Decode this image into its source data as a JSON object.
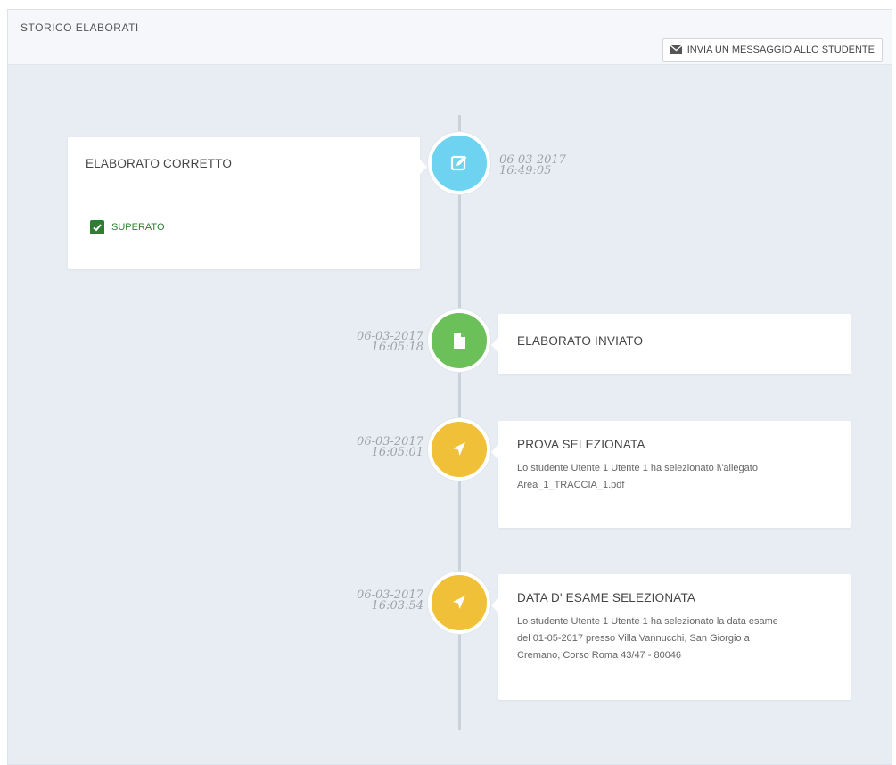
{
  "header": {
    "title": "STORICO ELABORATI",
    "message_button_label": "INVIA UN MESSAGGIO ALLO STUDENTE",
    "message_button_icon": "envelope-icon"
  },
  "events": [
    {
      "date": "06-03-2017",
      "time": "16:49:05",
      "title": "ELABORATO CORRETTO",
      "status": "SUPERATO",
      "icon": "edit-icon",
      "color": "#6dd3f0",
      "side": "left"
    },
    {
      "date": "06-03-2017",
      "time": "16:05:18",
      "title": "ELABORATO INVIATO",
      "icon": "file-icon",
      "color": "#6cc05a",
      "side": "right"
    },
    {
      "date": "06-03-2017",
      "time": "16:05:01",
      "title": "PROVA SELEZIONATA",
      "text_lines": [
        "Lo studente Utente 1 Utente 1 ha selezionato l\\'allegato",
        "Area_1_TRACCIA_1.pdf"
      ],
      "icon": "location-arrow-icon",
      "color": "#f0c039",
      "side": "right"
    },
    {
      "date": "06-03-2017",
      "time": "16:03:54",
      "title": "DATA D' ESAME SELEZIONATA",
      "text_lines": [
        "Lo studente Utente 1 Utente 1 ha selezionato la data esame",
        "del 01-05-2017 presso Villa Vannucchi, San Giorgio a",
        "Cremano, Corso Roma 43/47 - 80046"
      ],
      "icon": "location-arrow-icon",
      "color": "#f0c039",
      "side": "right"
    }
  ],
  "colors": {
    "panel_bg": "#e8edf3",
    "success": "#2e7d32",
    "cyan": "#6dd3f0",
    "green": "#6cc05a",
    "yellow": "#f0c039"
  }
}
